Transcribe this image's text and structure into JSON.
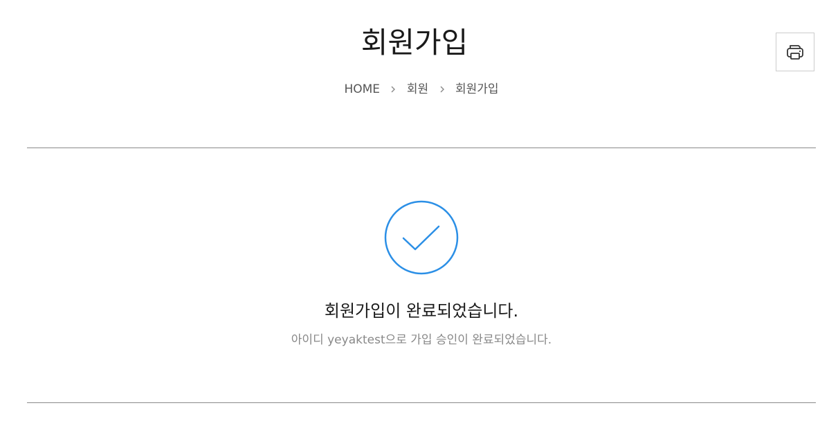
{
  "header": {
    "title": "회원가입",
    "breadcrumb": [
      {
        "label": "HOME"
      },
      {
        "label": "회원"
      },
      {
        "label": "회원가입"
      }
    ],
    "print_icon": "printer-icon"
  },
  "result": {
    "icon": "check-circle-icon",
    "title": "회원가입이 완료되었습니다.",
    "description": "아이디 yeyaktest으로 가입 승인이 완료되었습니다."
  },
  "colors": {
    "accent": "#2b8fe6",
    "divider": "#8a8a8a",
    "muted_text": "#888888"
  }
}
